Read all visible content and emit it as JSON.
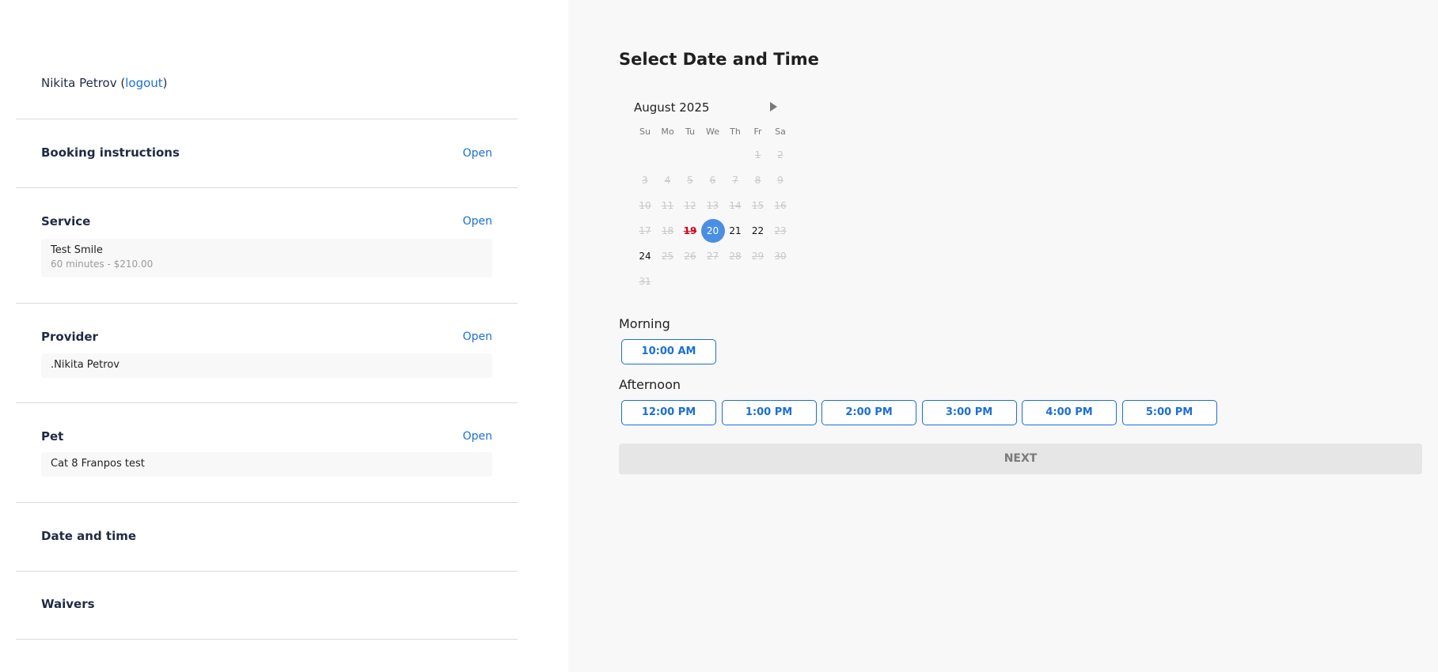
{
  "user": {
    "name": "Nikita Petrov",
    "logout_label": "logout"
  },
  "sections": {
    "booking": {
      "title": "Booking instructions",
      "open_label": "Open"
    },
    "service": {
      "title": "Service",
      "open_label": "Open",
      "name": "Test Smile",
      "detail": "60 minutes - $210.00"
    },
    "provider": {
      "title": "Provider",
      "open_label": "Open",
      "name": ".Nikita Petrov"
    },
    "pet": {
      "title": "Pet",
      "open_label": "Open",
      "name": "Cat 8 Franpos test"
    },
    "datetime": {
      "title": "Date and time"
    },
    "waivers": {
      "title": "Waivers"
    }
  },
  "main": {
    "title": "Select Date and Time",
    "calendar": {
      "month_label": "August 2025",
      "weekdays": [
        "Su",
        "Mo",
        "Tu",
        "We",
        "Th",
        "Fr",
        "Sa"
      ],
      "first_weekday_index": 5,
      "days_in_month": 31,
      "available_days": [
        20,
        21,
        22,
        24
      ],
      "today": 19,
      "selected": 20
    },
    "morning": {
      "label": "Morning",
      "slots": [
        "10:00 AM"
      ]
    },
    "afternoon": {
      "label": "Afternoon",
      "slots": [
        "12:00 PM",
        "1:00 PM",
        "2:00 PM",
        "3:00 PM",
        "4:00 PM",
        "5:00 PM"
      ]
    },
    "next_label": "NEXT"
  },
  "colors": {
    "accent": "#1a6fd6",
    "selected_day": "#4a8fe3",
    "today_day": "#d0021b"
  }
}
